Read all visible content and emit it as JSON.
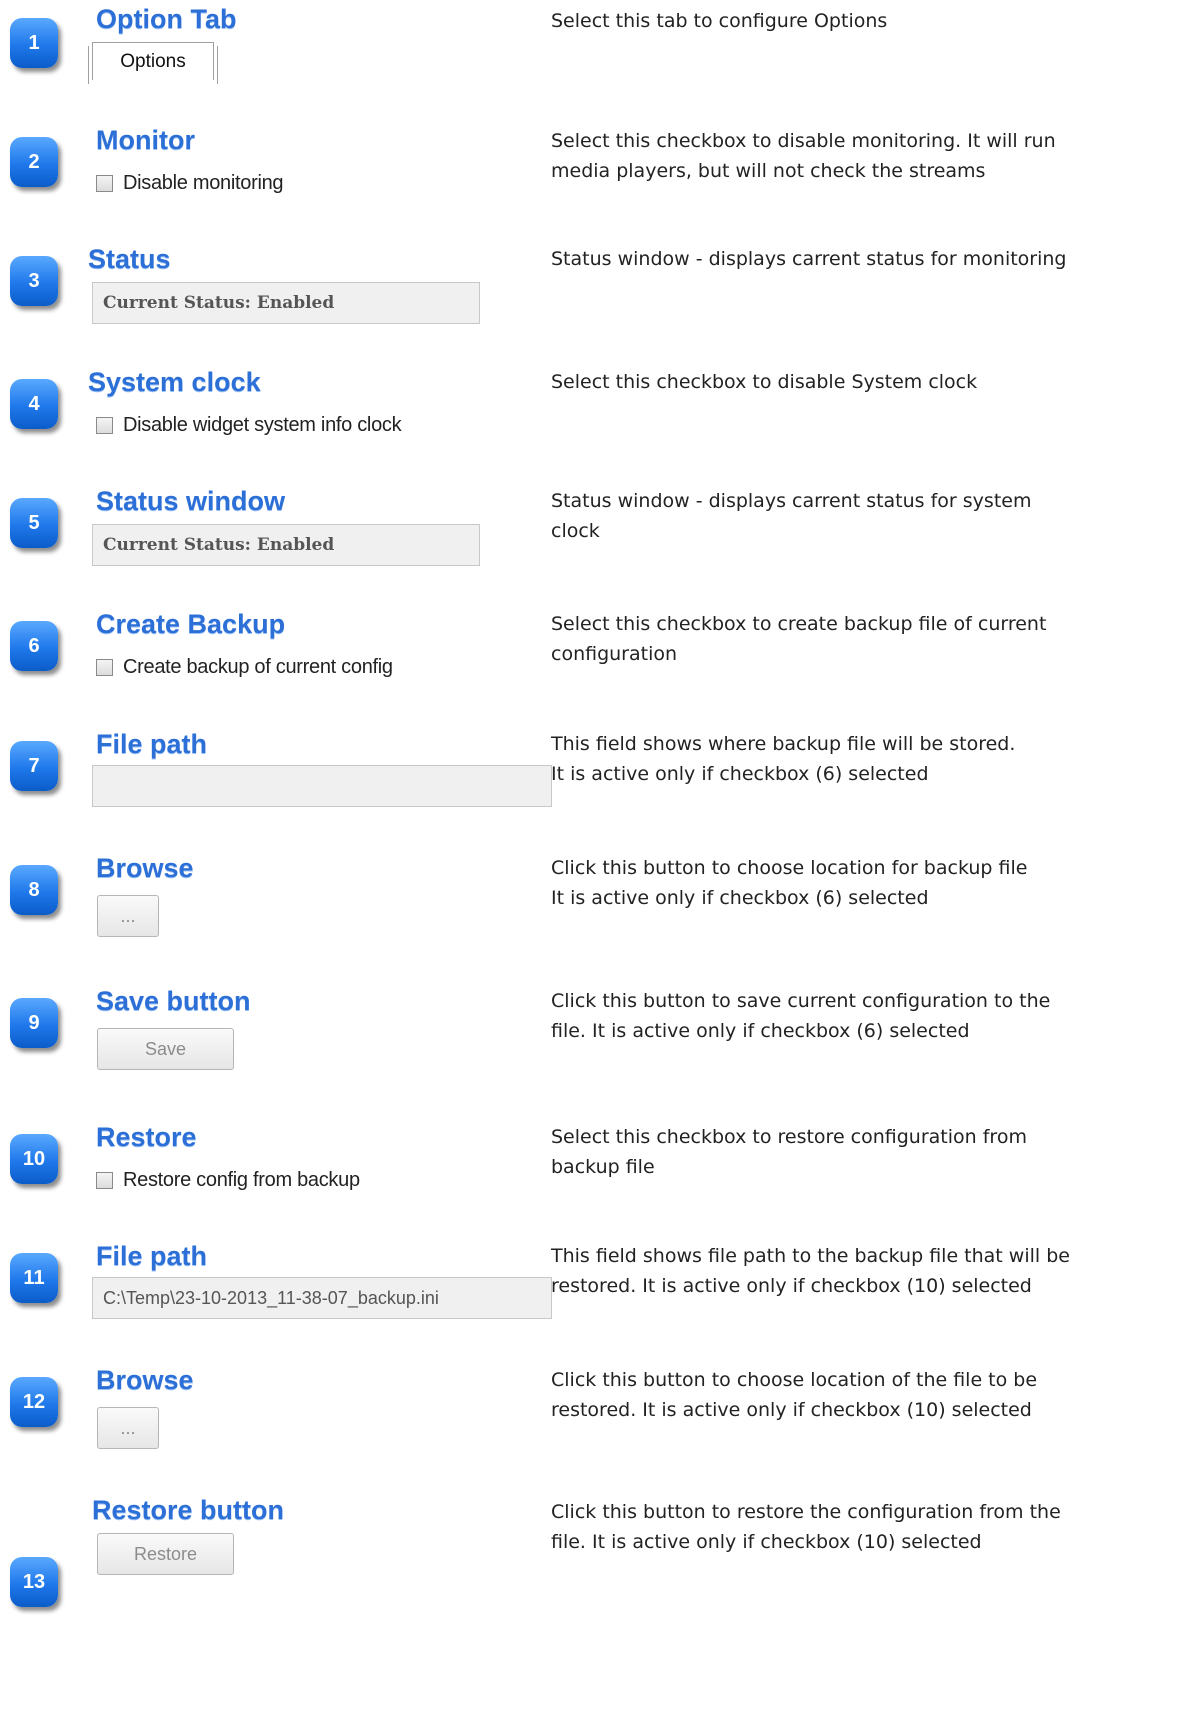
{
  "sections": [
    {
      "num": "1",
      "title": "Option Tab",
      "desc": [
        "Select this tab to configure Options"
      ],
      "tab_label": "Options"
    },
    {
      "num": "2",
      "title": "Monitor",
      "desc": [
        "Select this checkbox to disable monitoring. It will run",
        "media players, but will not check the streams"
      ],
      "checkbox_label": "Disable monitoring"
    },
    {
      "num": "3",
      "title": "Status",
      "desc": [
        "Status window - displays carrent status for monitoring"
      ],
      "field_value": "Current Status: Enabled"
    },
    {
      "num": "4",
      "title": "System clock",
      "desc": [
        "Select this checkbox to disable System clock"
      ],
      "checkbox_label": "Disable widget system info clock"
    },
    {
      "num": "5",
      "title": "Status window",
      "desc": [
        "Status window - displays carrent status for system",
        "clock"
      ],
      "field_value": "Current Status: Enabled"
    },
    {
      "num": "6",
      "title": "Create Backup",
      "desc": [
        "Select this checkbox to create backup file of current",
        "configuration"
      ],
      "checkbox_label": "Create backup of current config"
    },
    {
      "num": "7",
      "title": "File path",
      "desc": [
        "This field shows where backup file will be stored.",
        "It is active only if checkbox (6) selected"
      ],
      "field_value": ""
    },
    {
      "num": "8",
      "title": "Browse",
      "desc": [
        "Click this button to choose location for backup file",
        "It is active only if checkbox (6) selected"
      ],
      "button_label": "..."
    },
    {
      "num": "9",
      "title": "Save button",
      "desc": [
        "Click this button to save current configuration to the",
        "file. It is active only if checkbox (6) selected"
      ],
      "button_label": "Save"
    },
    {
      "num": "10",
      "title": "Restore",
      "desc": [
        "Select this checkbox to restore configuration from",
        "backup file"
      ],
      "checkbox_label": "Restore config from backup"
    },
    {
      "num": "11",
      "title": "File path",
      "desc": [
        "This field shows file path to the backup file that will be",
        "restored. It is active only if checkbox (10) selected"
      ],
      "field_value": "C:\\Temp\\23-10-2013_11-38-07_backup.ini"
    },
    {
      "num": "12",
      "title": "Browse",
      "desc": [
        "Click this button to choose location of the file to be",
        "restored. It is active only if checkbox (10) selected"
      ],
      "button_label": "..."
    },
    {
      "num": "13",
      "title": "Restore button",
      "desc": [
        "Click this button to restore the configuration from the",
        "file. It is active only if checkbox (10) selected"
      ],
      "button_label": "Restore"
    }
  ]
}
